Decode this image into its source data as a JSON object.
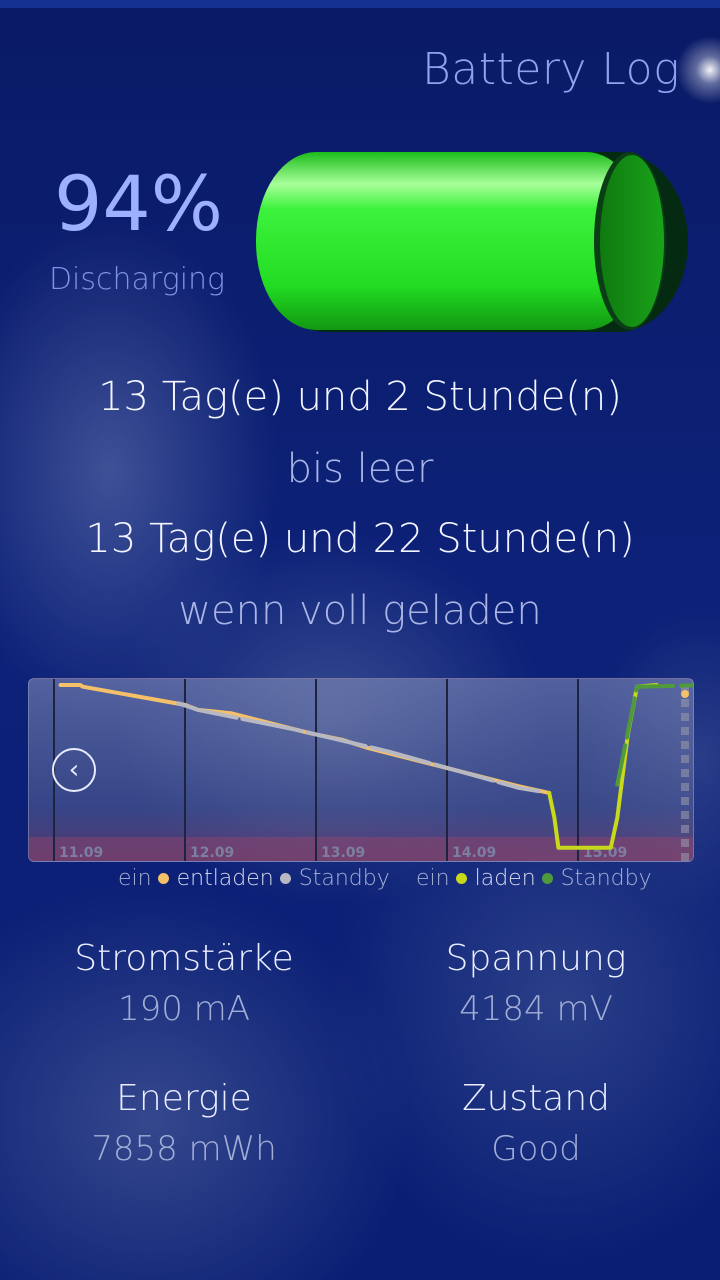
{
  "app": {
    "title": "Battery Log"
  },
  "battery": {
    "percent_text": "94%",
    "level": 0.94,
    "status": "Discharging",
    "fill_color": "#22e222"
  },
  "estimates": {
    "time_to_empty": "13 Tag(e) und 2 Stunde(n)",
    "time_to_empty_label": "bis leer",
    "time_full": "13 Tag(e) und 22 Stunde(n)",
    "time_full_label": "wenn voll geladen"
  },
  "chart_data": {
    "type": "line",
    "x_tick_labels": [
      "11.09",
      "12.09",
      "13.09",
      "14.09",
      "15.09"
    ],
    "ylim": [
      0,
      100
    ],
    "series": [
      {
        "name": "entladen",
        "color": "#f4c06a",
        "points": [
          [
            0.05,
            100
          ],
          [
            0.2,
            100
          ],
          [
            0.22,
            99
          ],
          [
            1.0,
            88
          ],
          [
            1.1,
            85
          ],
          [
            1.35,
            83
          ],
          [
            1.95,
            71
          ],
          [
            2.2,
            67
          ],
          [
            2.4,
            62
          ],
          [
            3.55,
            39
          ],
          [
            3.78,
            35
          ]
        ]
      },
      {
        "name": "Standby",
        "color": "#b8b8c2",
        "points": [
          [
            0.95,
            89
          ],
          [
            1.1,
            85
          ],
          [
            1.6,
            77
          ],
          [
            1.85,
            73
          ],
          [
            2.55,
            60
          ],
          [
            3.55,
            38
          ],
          [
            3.7,
            36
          ]
        ]
      },
      {
        "name": "laden",
        "color": "#c8d81a",
        "points": [
          [
            3.78,
            35
          ],
          [
            3.82,
            20
          ],
          [
            3.85,
            2
          ],
          [
            4.25,
            2
          ],
          [
            4.3,
            20
          ],
          [
            4.38,
            70
          ],
          [
            4.45,
            99
          ],
          [
            4.6,
            100
          ]
        ]
      },
      {
        "name": "Standby",
        "color": "#4f9a3a",
        "points": [
          [
            4.3,
            40
          ],
          [
            4.45,
            99
          ],
          [
            5.0,
            100
          ],
          [
            5.5,
            100
          ]
        ]
      }
    ],
    "legend_on": {
      "left": "ein",
      "right": "ein"
    },
    "legend": {
      "left": {
        "label1": "entladen",
        "label2": "Standby",
        "dot1": "#f4c06a",
        "dot2": "#b8b8c2"
      },
      "right": {
        "label1": "laden",
        "label2": "Standby",
        "dot1": "#c8d81a",
        "dot2": "#4f9a3a"
      }
    }
  },
  "stats": {
    "current": {
      "label": "Stromstärke",
      "value": "190 mA"
    },
    "voltage": {
      "label": "Spannung",
      "value": "4184 mV"
    },
    "energy": {
      "label": "Energie",
      "value": "7858 mWh"
    },
    "health": {
      "label": "Zustand",
      "value": "Good"
    }
  }
}
